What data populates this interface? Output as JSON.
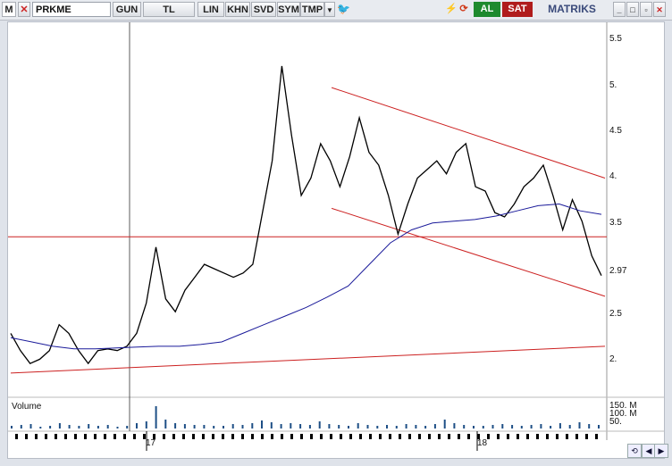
{
  "toolbar": {
    "m_label": "M",
    "symbol": "PRKME",
    "period": "GUN",
    "currency": "TL",
    "scale": "LIN",
    "khn": "KHN",
    "svd": "SVD",
    "sym": "SYM",
    "tmp": "TMP",
    "buy": "AL",
    "sell": "SAT",
    "brand": "MATRIKS",
    "colors": {
      "buy": "#1e8a2e",
      "sell": "#b01c1c",
      "brand": "#3a4a7a"
    }
  },
  "chart": {
    "price_ticks": [
      "5.5",
      "5.",
      "4.5",
      "4.",
      "3.5",
      "2.97",
      "2.5",
      "2."
    ],
    "last_price": "2.97",
    "volume_label": "Volume",
    "volume_ticks": [
      "150. M",
      "100. M",
      "50."
    ],
    "x_labels": [
      "17",
      "18"
    ],
    "colors": {
      "price": "#000000",
      "ma": "#1a1a9a",
      "trend": "#cc2020",
      "volume": "#1e4f86"
    }
  },
  "chart_data": {
    "type": "line",
    "title": "",
    "xlabel": "",
    "ylabel": "",
    "ylim": [
      1.6,
      5.7
    ],
    "x_ticks": [
      "17",
      "18"
    ],
    "series": [
      {
        "values": [
          2.3,
          2.1,
          1.95,
          2.0,
          2.1,
          2.4,
          2.3,
          2.1,
          1.95,
          2.1,
          2.12,
          2.1,
          2.15,
          2.3,
          2.65,
          3.3,
          2.7,
          2.55,
          2.8,
          2.95,
          3.1,
          3.05,
          3.0,
          2.95,
          3.0,
          3.1,
          3.7,
          4.3,
          5.4,
          4.6,
          3.9,
          4.1,
          4.5,
          4.3,
          4.0,
          4.35,
          4.8,
          4.4,
          4.25,
          3.9,
          3.45,
          3.8,
          4.1,
          4.2,
          4.3,
          4.15,
          4.4,
          4.5,
          4.0,
          3.95,
          3.7,
          3.65,
          3.8,
          4.0,
          4.1,
          4.25,
          3.9,
          3.5,
          3.85,
          3.6,
          3.2,
          2.97
        ]
      },
      {
        "values": [
          2.25,
          2.2,
          2.15,
          2.12,
          2.12,
          2.13,
          2.14,
          2.15,
          2.15,
          2.17,
          2.2,
          2.3,
          2.4,
          2.5,
          2.6,
          2.72,
          2.85,
          3.1,
          3.35,
          3.5,
          3.58,
          3.6,
          3.62,
          3.66,
          3.72,
          3.78,
          3.8,
          3.72,
          3.68
        ]
      }
    ],
    "horizontal_lines": [
      3.42
    ],
    "trend_lines": [
      {
        "from": [
          0.54,
          5.15
        ],
        "to": [
          1.0,
          4.1
        ]
      },
      {
        "from": [
          0.54,
          3.75
        ],
        "to": [
          1.0,
          2.73
        ]
      },
      {
        "from": [
          0.0,
          1.84
        ],
        "to": [
          1.0,
          2.15
        ]
      }
    ]
  }
}
